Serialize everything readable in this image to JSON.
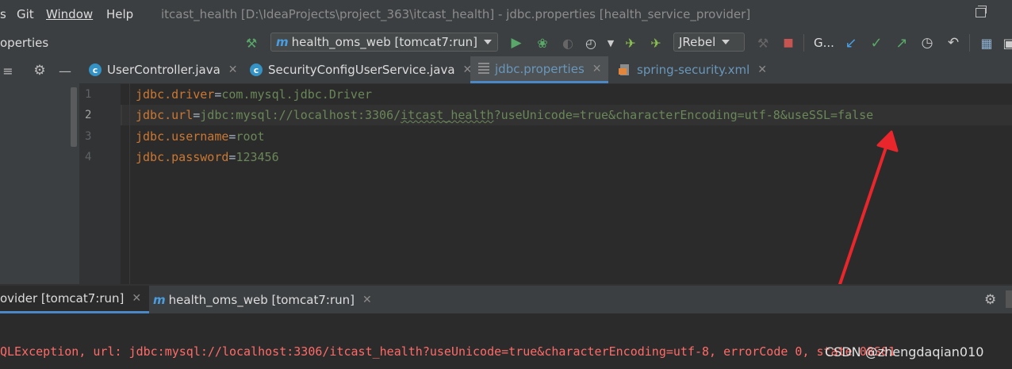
{
  "menubar": {
    "items": [
      "s",
      "Git",
      "Window",
      "Help"
    ],
    "title": "itcast_health [D:\\IdeaProjects\\project_363\\itcast_health] - jdbc.properties [health_service_provider]"
  },
  "toolbar": {
    "breadcrumb": "operties",
    "run_config": "health_oms_web [tomcat7:run]",
    "jrebel": "JRebel",
    "git_label": "G..."
  },
  "tabs": [
    {
      "label": "UserController.java",
      "icon": "java-class-icon"
    },
    {
      "label": "SecurityConfigUserService.java",
      "icon": "java-class-icon"
    },
    {
      "label": "jdbc.properties",
      "icon": "properties-file-icon",
      "active": true
    },
    {
      "label": "spring-security.xml",
      "icon": "xml-file-icon"
    }
  ],
  "editor": {
    "lines": [
      {
        "num": "1",
        "key": "jdbc.driver",
        "sep": "=",
        "value": "com.mysql.jdbc.Driver"
      },
      {
        "num": "2",
        "key": "jdbc.url",
        "sep": "=",
        "value_a": "jdbc:mysql://localhost:3306/",
        "value_b": "itcast_health",
        "value_c": "?useUnicode=true&characterEncoding=utf-8&useSSL=false"
      },
      {
        "num": "3",
        "key": "jdbc.username",
        "sep": "=",
        "value": "root"
      },
      {
        "num": "4",
        "key": "jdbc.password",
        "sep": "=",
        "value": "123456"
      }
    ]
  },
  "run_panel": {
    "tabs": [
      "ovider [tomcat7:run]",
      "health_oms_web [tomcat7:run]"
    ],
    "console_text": "QLException, url: jdbc:mysql://localhost:3306/itcast_health?useUnicode=true&characterEncoding=utf-8, errorCode 0, state 08S01"
  },
  "watermark": "CSDN @zhengdaqian010",
  "colors": {
    "background": "#2b2b2b",
    "key": "#cc7832",
    "value": "#6a8759",
    "error": "#ff6b68",
    "annotation_arrow": "#e8262b"
  }
}
